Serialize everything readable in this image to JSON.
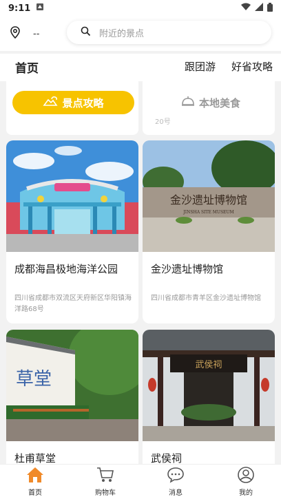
{
  "status": {
    "time": "9:11"
  },
  "top": {
    "location_value": "--",
    "search_placeholder": "附近的景点"
  },
  "tabs": {
    "home": "首页",
    "group": "跟团游",
    "guide": "好省攻略"
  },
  "pills": {
    "active": "景点攻略",
    "inactive": "本地美食"
  },
  "peek": {
    "right_text": "20号"
  },
  "cards": [
    {
      "title": "成都海昌极地海洋公园",
      "address": "四川省成都市双流区天府新区华阳镇海洋路68号"
    },
    {
      "title": "金沙遗址博物馆",
      "address": "四川省成都市青羊区金沙遗址博物馆"
    },
    {
      "title": "杜甫草堂",
      "address": ""
    },
    {
      "title": "武侯祠",
      "address": ""
    }
  ],
  "images": {
    "museum_sign": "金沙遗址博物馆",
    "museum_sign_en": "JINSHA SITE MUSEUM",
    "cottage_sign": "草堂",
    "temple_sign": "武侯祠"
  },
  "nav": [
    {
      "label": "首页",
      "icon": "home-icon"
    },
    {
      "label": "购物车",
      "icon": "cart-icon"
    },
    {
      "label": "消息",
      "icon": "message-icon"
    },
    {
      "label": "我的",
      "icon": "profile-icon"
    }
  ],
  "colors": {
    "accent": "#f7c300",
    "nav_home": "#f08a2a"
  }
}
